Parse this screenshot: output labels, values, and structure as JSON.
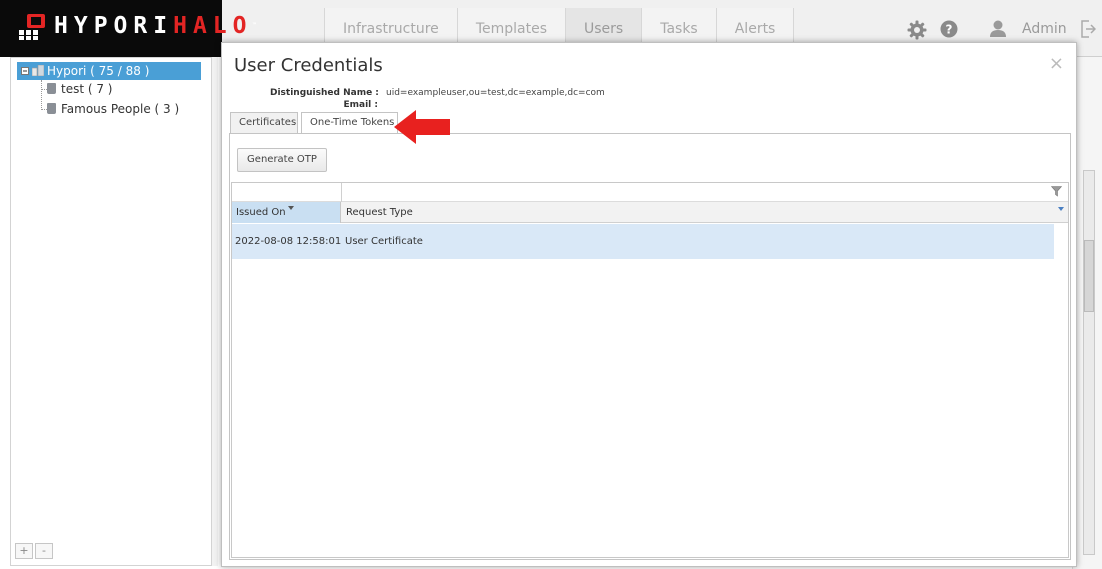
{
  "brand": {
    "name_white": "HYPORI",
    "name_red": "HALO",
    "mark": "™"
  },
  "nav": {
    "tabs": [
      "Infrastructure",
      "Templates",
      "Users",
      "Tasks",
      "Alerts"
    ],
    "active": "Users"
  },
  "header": {
    "user_label": "Admin",
    "icons": [
      "gear-icon",
      "help-icon",
      "user-icon",
      "logout-icon"
    ]
  },
  "tree": {
    "root": "Hypori ( 75 / 88 )",
    "children": [
      "test ( 7 )",
      "Famous People ( 3 )"
    ],
    "footer": {
      "add": "+",
      "remove": "-"
    }
  },
  "modal": {
    "title": "User Credentials",
    "close": "×",
    "dn_label": "Distinguished Name :",
    "dn_value": "uid=exampleuser,ou=test,dc=example,dc=com",
    "email_label": "Email :",
    "email_value": "",
    "tabs": [
      "Certificates",
      "One-Time Tokens"
    ],
    "active_tab": "One-Time Tokens",
    "generate_label": "Generate OTP",
    "grid": {
      "columns": [
        "Issued On",
        "Request Type"
      ],
      "rows": [
        {
          "issued_on": "2022-08-08 12:58:01",
          "request_type": "User Certificate"
        }
      ]
    }
  },
  "colors": {
    "brand_red": "#e32524",
    "selection_blue": "#4a9fd6",
    "row_highlight": "#d9e8f7",
    "annotation_arrow": "#e8211f"
  }
}
